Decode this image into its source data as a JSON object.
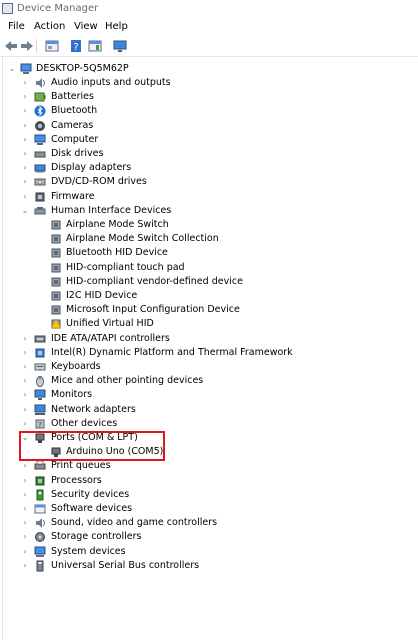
{
  "window": {
    "title": "Device Manager"
  },
  "menu": [
    "File",
    "Action",
    "View",
    "Help"
  ],
  "toolbar": [
    {
      "name": "back-icon"
    },
    {
      "name": "forward-icon"
    },
    {
      "name": "properties-icon"
    },
    {
      "name": "help-icon"
    },
    {
      "name": "view-icon"
    },
    {
      "name": "monitor-icon"
    }
  ],
  "tree": {
    "root": "DESKTOP-5Q5M62P",
    "items": [
      {
        "label": "Audio inputs and outputs",
        "icon": "speaker-icon",
        "expanded": false
      },
      {
        "label": "Batteries",
        "icon": "battery-icon",
        "expanded": false
      },
      {
        "label": "Bluetooth",
        "icon": "bluetooth-icon",
        "expanded": false
      },
      {
        "label": "Cameras",
        "icon": "camera-icon",
        "expanded": false
      },
      {
        "label": "Computer",
        "icon": "computer-icon",
        "expanded": false
      },
      {
        "label": "Disk drives",
        "icon": "disk-drive-icon",
        "expanded": false
      },
      {
        "label": "Display adapters",
        "icon": "display-adapter-icon",
        "expanded": false
      },
      {
        "label": "DVD/CD-ROM drives",
        "icon": "dvd-icon",
        "expanded": false
      },
      {
        "label": "Firmware",
        "icon": "firmware-icon",
        "expanded": false
      },
      {
        "label": "Human Interface Devices",
        "icon": "hid-icon",
        "expanded": true,
        "children": [
          "Airplane Mode Switch",
          "Airplane Mode Switch Collection",
          "Bluetooth HID Device",
          "HID-compliant touch pad",
          "HID-compliant vendor-defined device",
          "I2C HID Device",
          "Microsoft Input Configuration Device",
          "Unified Virtual HID"
        ]
      },
      {
        "label": "IDE ATA/ATAPI controllers",
        "icon": "ide-icon",
        "expanded": false
      },
      {
        "label": "Intel(R) Dynamic Platform and Thermal Framework",
        "icon": "chip-icon",
        "expanded": false
      },
      {
        "label": "Keyboards",
        "icon": "keyboard-icon",
        "expanded": false
      },
      {
        "label": "Mice and other pointing devices",
        "icon": "mouse-icon",
        "expanded": false
      },
      {
        "label": "Monitors",
        "icon": "monitor-icon",
        "expanded": false
      },
      {
        "label": "Network adapters",
        "icon": "network-icon",
        "expanded": false
      },
      {
        "label": "Other devices",
        "icon": "other-devices-icon",
        "expanded": false
      },
      {
        "label": "Ports (COM & LPT)",
        "icon": "port-icon",
        "expanded": true,
        "children": [
          "Arduino Uno (COM5)"
        ]
      },
      {
        "label": "Print queues",
        "icon": "printer-icon",
        "expanded": false
      },
      {
        "label": "Processors",
        "icon": "processor-icon",
        "expanded": false
      },
      {
        "label": "Security devices",
        "icon": "security-icon",
        "expanded": false
      },
      {
        "label": "Software devices",
        "icon": "software-icon",
        "expanded": false
      },
      {
        "label": "Sound, video and game controllers",
        "icon": "sound-icon",
        "expanded": false
      },
      {
        "label": "Storage controllers",
        "icon": "storage-icon",
        "expanded": false
      },
      {
        "label": "System devices",
        "icon": "system-icon",
        "expanded": false
      },
      {
        "label": "Universal Serial Bus controllers",
        "icon": "usb-icon",
        "expanded": false
      }
    ]
  },
  "colors": {
    "highlight_border": "#e0161f",
    "title_text": "#6a6a6a"
  }
}
